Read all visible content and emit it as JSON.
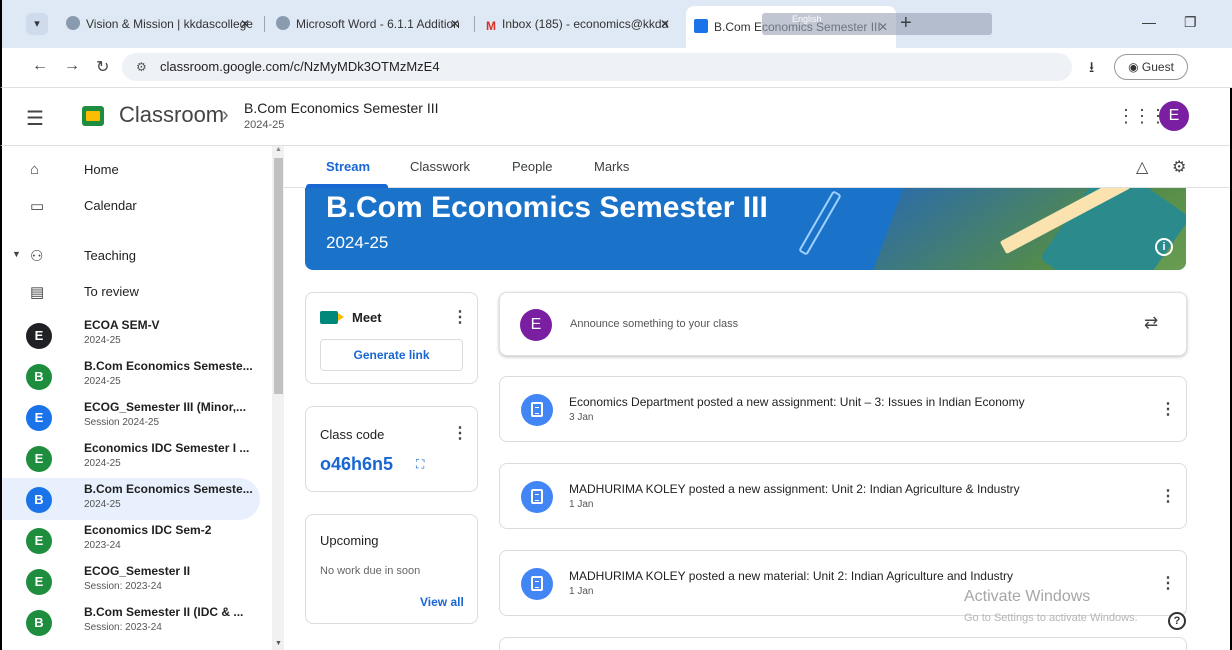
{
  "browser": {
    "tabs": [
      {
        "title": "Vision & Mission | kkdascollege",
        "icon": "site-favicon"
      },
      {
        "title": "Microsoft Word - 6.1.1 Addition",
        "icon": "site-favicon"
      },
      {
        "title": "Inbox (185) - economics@kkda",
        "icon": "gmail-favicon"
      },
      {
        "title": "B.Com Economics Semester III",
        "icon": "classroom-favicon"
      }
    ],
    "ime_label": "English",
    "url": "classroom.google.com/c/NzMyMDk3OTMzMzE4",
    "profile_label": "Guest"
  },
  "header": {
    "app_name": "Classroom",
    "class_title": "B.Com Economics Semester III",
    "class_session": "2024-25",
    "user_initial": "E"
  },
  "sidebar": {
    "home": "Home",
    "calendar": "Calendar",
    "teaching": "Teaching",
    "to_review": "To review",
    "courses": [
      {
        "initial": "E",
        "title": "ECOA SEM-V",
        "subtitle": "2024-25",
        "color": "#202124"
      },
      {
        "initial": "B",
        "title": "B.Com Economics Semeste...",
        "subtitle": "2024-25",
        "color": "#1e8e3e"
      },
      {
        "initial": "E",
        "title": "ECOG_Semester III (Minor,...",
        "subtitle": "Session 2024-25",
        "color": "#1a73e8"
      },
      {
        "initial": "E",
        "title": "Economics IDC Semester I ...",
        "subtitle": "2024-25",
        "color": "#1e8e3e"
      },
      {
        "initial": "B",
        "title": "B.Com Economics Semeste...",
        "subtitle": "2024-25",
        "color": "#1a73e8"
      },
      {
        "initial": "E",
        "title": "Economics IDC Sem-2",
        "subtitle": "2023-24",
        "color": "#1e8e3e"
      },
      {
        "initial": "E",
        "title": "ECOG_Semester II",
        "subtitle": "Session: 2023-24",
        "color": "#1e8e3e"
      },
      {
        "initial": "B",
        "title": "B.Com Semester II (IDC & ...",
        "subtitle": "Session: 2023-24",
        "color": "#1e8e3e"
      }
    ]
  },
  "nav_tabs": {
    "stream": "Stream",
    "classwork": "Classwork",
    "people": "People",
    "marks": "Marks"
  },
  "banner": {
    "title": "B.Com Economics Semester III",
    "session": "2024-25",
    "color": "#1a73c8"
  },
  "meet": {
    "label": "Meet",
    "button": "Generate link"
  },
  "class_code": {
    "label": "Class code",
    "value": "o46h6n5"
  },
  "upcoming": {
    "label": "Upcoming",
    "empty": "No work due in soon",
    "view_all": "View all"
  },
  "announce": {
    "initial": "E",
    "placeholder": "Announce something to your class"
  },
  "posts": [
    {
      "text": "Economics Department posted a new assignment: Unit – 3: Issues in Indian Economy",
      "date": "3 Jan",
      "icon": "assignment-icon"
    },
    {
      "text": "MADHURIMA KOLEY posted a new assignment: Unit 2: Indian Agriculture & Industry",
      "date": "1 Jan",
      "icon": "assignment-icon"
    },
    {
      "text": "MADHURIMA KOLEY posted a new material: Unit 2: Indian Agriculture and Industry",
      "date": "1 Jan",
      "icon": "material-icon"
    }
  ],
  "watermark": {
    "line1": "Activate Windows",
    "line2": "Go to Settings to activate Windows."
  }
}
